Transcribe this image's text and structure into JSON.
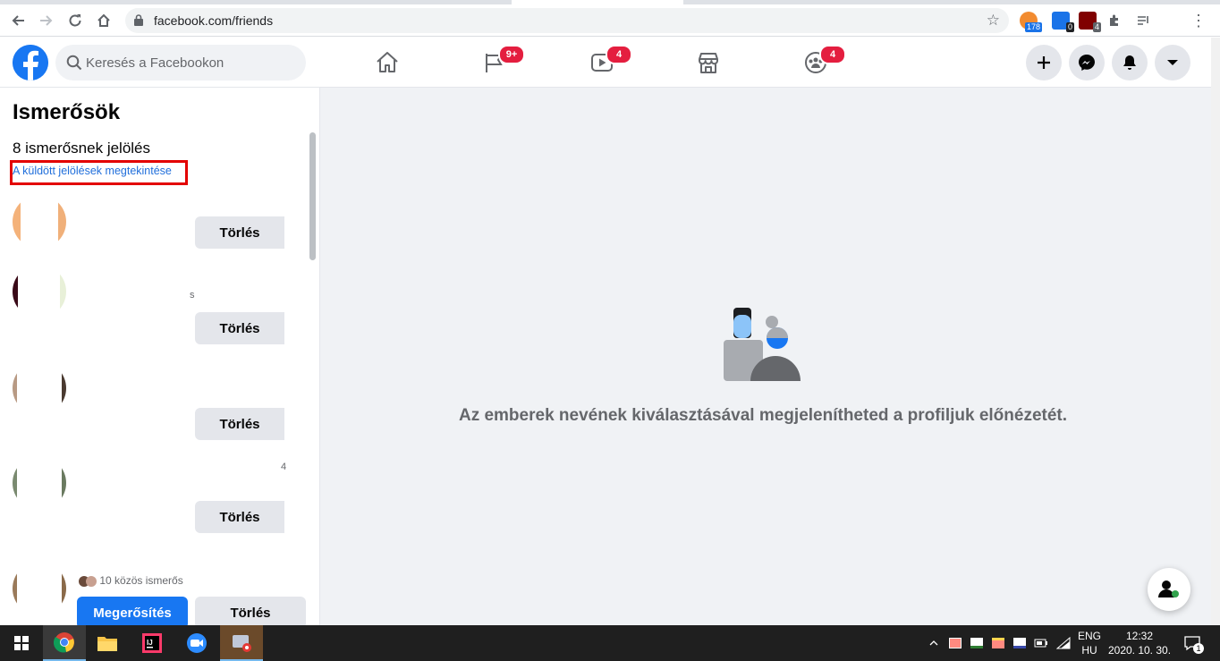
{
  "browser": {
    "url": "facebook.com/friends",
    "extensions": [
      {
        "name": "rss-extension-icon",
        "badge": "178",
        "color": "#f28b30"
      },
      {
        "name": "privacy-extension-icon",
        "badge": "0",
        "color": "#1a73e8"
      },
      {
        "name": "ublock-extension-icon",
        "badge": "4",
        "color": "#800000"
      }
    ]
  },
  "header": {
    "search_placeholder": "Keresés a Facebookon",
    "nav": [
      {
        "name": "home",
        "badge": ""
      },
      {
        "name": "pages",
        "badge": "9+"
      },
      {
        "name": "watch",
        "badge": "4"
      },
      {
        "name": "marketplace",
        "badge": ""
      },
      {
        "name": "groups",
        "badge": "4"
      }
    ]
  },
  "sidebar": {
    "title": "Ismerősök",
    "subtitle": "8 ismerősnek jelölés",
    "sent_requests_link": "A küldött jelölések megtekintése",
    "requests": [
      {
        "delete_label": "Törlés",
        "fragment": ""
      },
      {
        "delete_label": "Törlés",
        "fragment": "s"
      },
      {
        "delete_label": "Törlés",
        "fragment": ""
      },
      {
        "delete_label": "Törlés",
        "fragment": "4"
      },
      {
        "delete_label": "Törlés",
        "confirm_label": "Megerősítés",
        "mutual": "10 közös ismerős"
      }
    ]
  },
  "main": {
    "empty_message": "Az emberek nevének kiválasztásával megjelenítheted a profiljuk előnézetét."
  },
  "taskbar": {
    "language": "ENG",
    "region": "HU",
    "time": "12:32",
    "date": "2020. 10. 30.",
    "notification_count": "1"
  }
}
